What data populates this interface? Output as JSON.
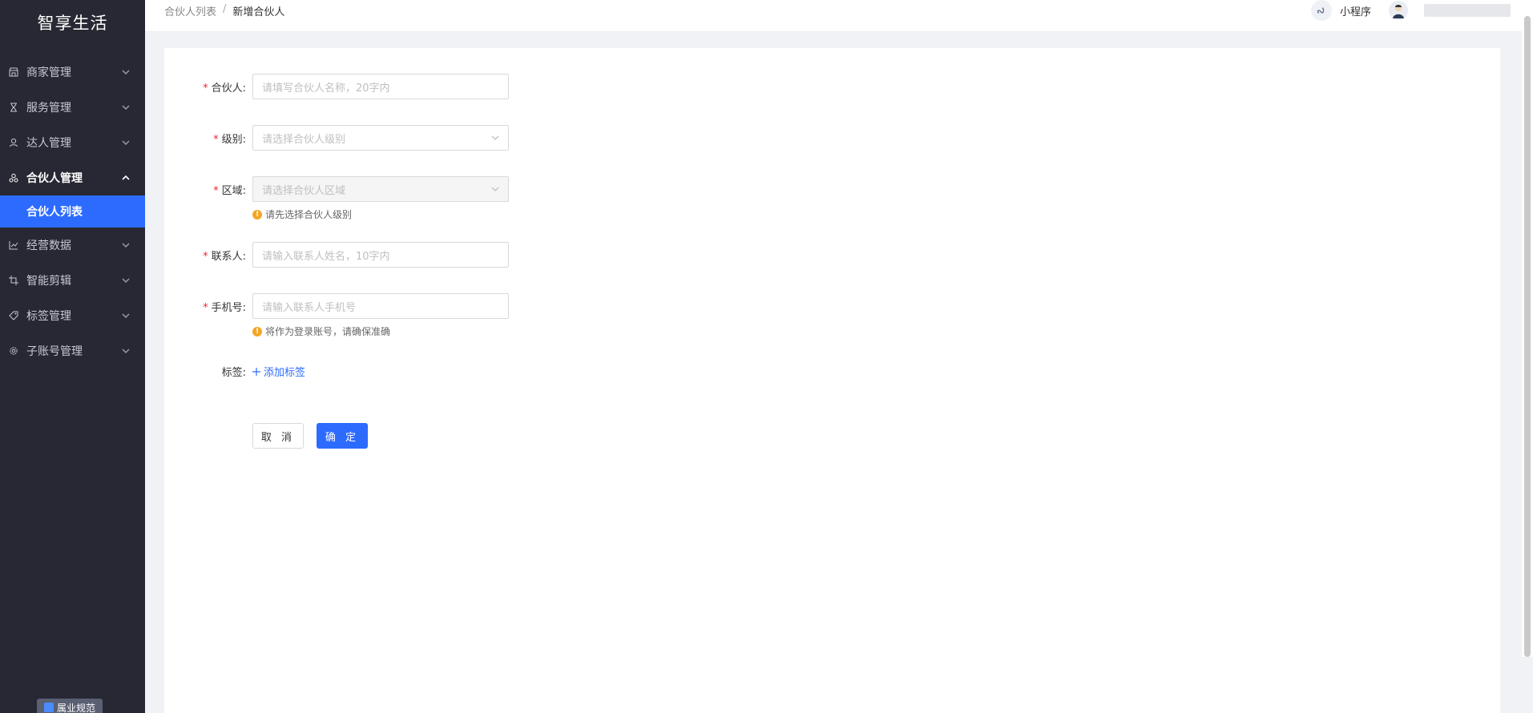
{
  "app": {
    "title": "智享生活"
  },
  "sidebar": {
    "items": [
      {
        "label": "商家管理",
        "icon": "store-icon"
      },
      {
        "label": "服务管理",
        "icon": "hourglass-icon"
      },
      {
        "label": "达人管理",
        "icon": "user-icon"
      },
      {
        "label": "合伙人管理",
        "icon": "partner-icon",
        "open": true,
        "children": [
          {
            "label": "合伙人列表",
            "active": true
          }
        ]
      },
      {
        "label": "经营数据",
        "icon": "chart-icon"
      },
      {
        "label": "智能剪辑",
        "icon": "crop-icon"
      },
      {
        "label": "标签管理",
        "icon": "tag-icon"
      },
      {
        "label": "子账号管理",
        "icon": "gear-icon"
      }
    ],
    "badge": "属业规范"
  },
  "header": {
    "breadcrumb": {
      "parent": "合伙人列表",
      "separator": "/",
      "current": "新增合伙人"
    },
    "miniprogram_label": "小程序"
  },
  "form": {
    "partner": {
      "label": "合伙人:",
      "placeholder": "请填写合伙人名称，20字内"
    },
    "level": {
      "label": "级别:",
      "placeholder": "请选择合伙人级别"
    },
    "region": {
      "label": "区域:",
      "placeholder": "请选择合伙人区域",
      "hint": "请先选择合伙人级别"
    },
    "contact": {
      "label": "联系人:",
      "placeholder": "请输入联系人姓名，10字内"
    },
    "phone": {
      "label": "手机号:",
      "placeholder": "请输入联系人手机号",
      "hint": "将作为登录账号，请确保准确"
    },
    "tags": {
      "label": "标签:",
      "add_label": "添加标签"
    },
    "cancel_label": "取 消",
    "ok_label": "确 定"
  },
  "colors": {
    "sidebar_bg": "#272833",
    "accent": "#2d6bff",
    "required": "#f5222d",
    "warning": "#f5a623"
  }
}
